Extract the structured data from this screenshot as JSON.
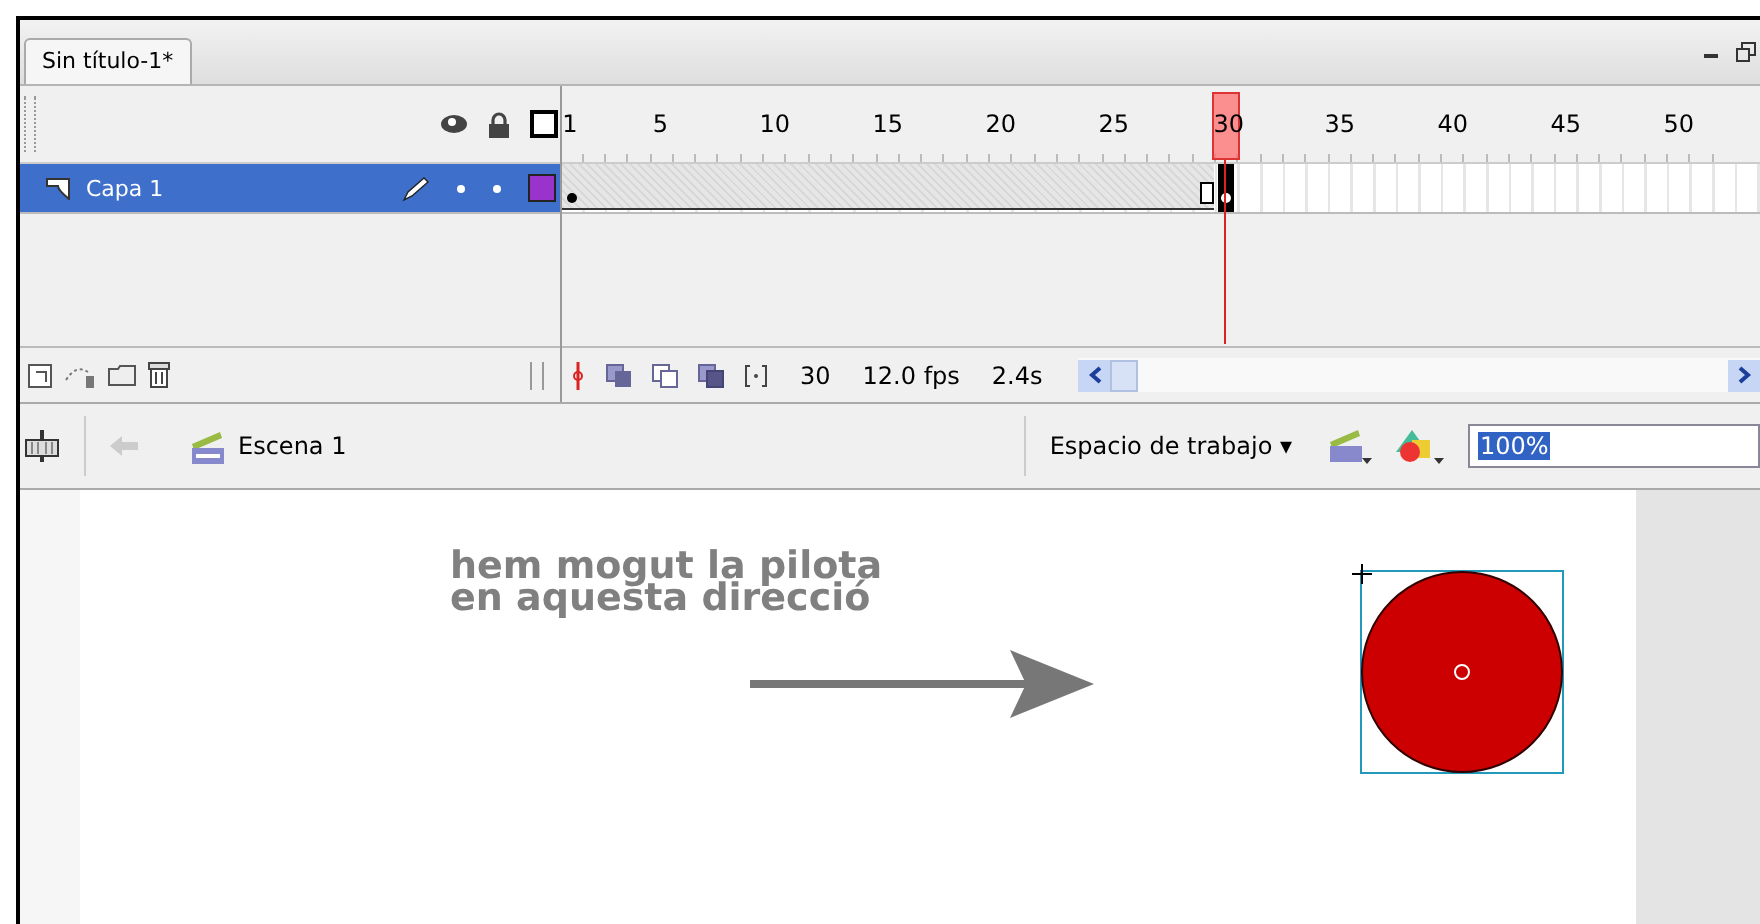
{
  "document_tab": {
    "label": "Sin título-1*",
    "selected": true
  },
  "timeline": {
    "frame_labels": [
      {
        "label": "1",
        "selected": false
      },
      {
        "label": "5",
        "selected": false
      },
      {
        "label": "10",
        "selected": false
      },
      {
        "label": "15",
        "selected": false
      },
      {
        "label": "20",
        "selected": false
      },
      {
        "label": "25",
        "selected": false
      },
      {
        "label": "30",
        "selected": true
      },
      {
        "label": "35",
        "selected": false
      },
      {
        "label": "40",
        "selected": false
      },
      {
        "label": "45",
        "selected": false
      },
      {
        "label": "50",
        "selected": false
      }
    ],
    "layers": [
      {
        "name": "Capa 1",
        "selected": true,
        "color": "#9933cc"
      }
    ],
    "current_frame": "30",
    "frame_rate": "12.0 fps",
    "elapsed_time": "2.4s"
  },
  "edit_bar": {
    "scene": "Escena 1",
    "workspace": "Espacio de trabajo ▾",
    "zoom": "100%"
  },
  "stage": {
    "annotation": "hem mogut la pilota\nen aquesta direcció"
  }
}
